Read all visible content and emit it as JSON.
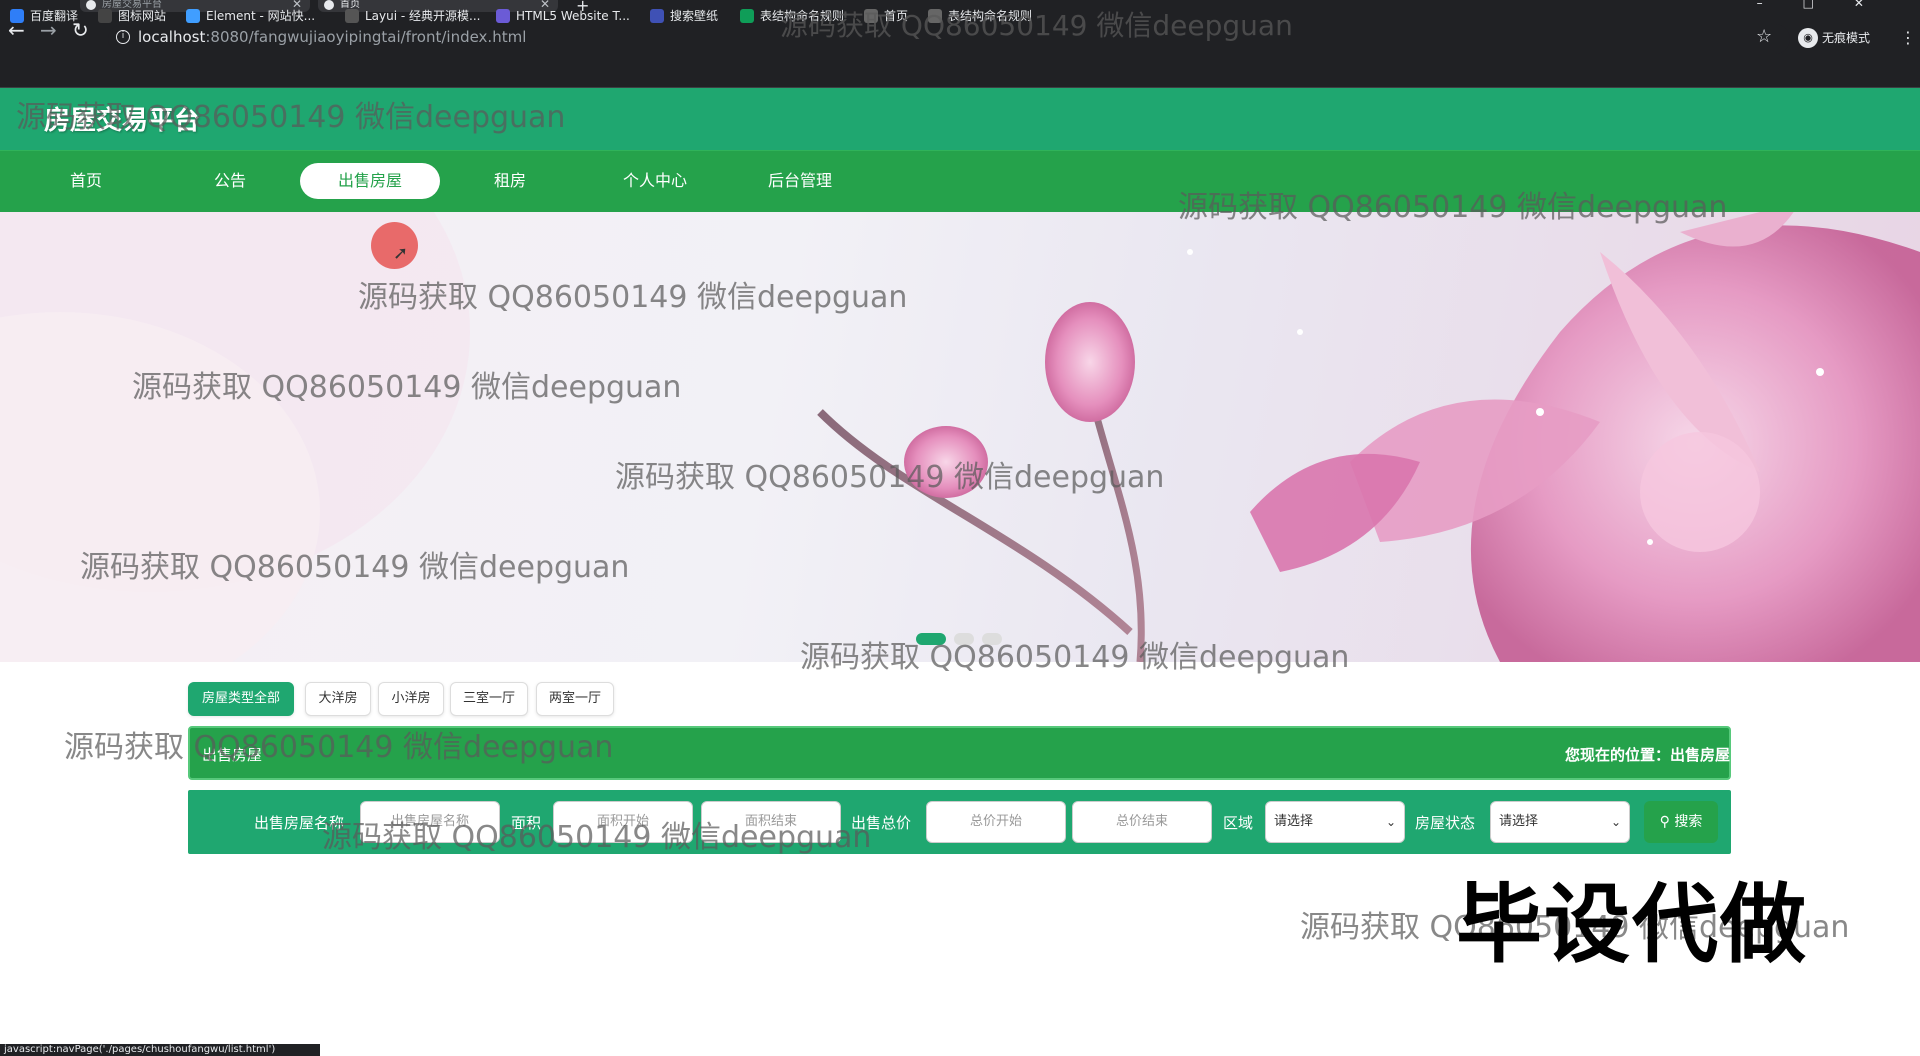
{
  "browser": {
    "tabs": [
      {
        "title": "房屋交易平台"
      },
      {
        "title": "首页"
      }
    ],
    "url_host": "localhost",
    "url_rest": ":8080/fangwujiaoyipingtai/front/index.html",
    "incognito_label": "无痕模式",
    "bookmarks": [
      {
        "label": "百度翻译",
        "icon": "baidu-translate-icon",
        "color": "#2f7ef7"
      },
      {
        "label": "图标网站",
        "icon": "flag-icon",
        "color": "#444"
      },
      {
        "label": "Element - 网站快...",
        "icon": "element-icon",
        "color": "#409eff"
      },
      {
        "label": "Layui - 经典开源模...",
        "icon": "layui-icon",
        "color": "#555"
      },
      {
        "label": "HTML5 Website T...",
        "icon": "html5-icon",
        "color": "#6b5bd6"
      },
      {
        "label": "搜索壁纸",
        "icon": "wallpaper-icon",
        "color": "#3f51b5"
      },
      {
        "label": "表结构命名规则",
        "icon": "sheet-icon",
        "color": "#0f9d58"
      },
      {
        "label": "首页",
        "icon": "globe-icon",
        "color": "#666"
      },
      {
        "label": "表结构命名规则",
        "icon": "globe-icon",
        "color": "#666"
      }
    ],
    "status_url": "javascript:navPage('./pages/chushoufangwu/list.html')"
  },
  "site": {
    "title": "房屋交易平台",
    "nav": [
      "首页",
      "公告",
      "出售房屋",
      "租房",
      "个人中心",
      "后台管理"
    ],
    "active_nav": "出售房屋"
  },
  "filters": {
    "house_types": [
      "房屋类型全部",
      "大洋房",
      "小洋房",
      "三室一厅",
      "两室一厅"
    ]
  },
  "breadcrumb": {
    "title": "出售房屋",
    "location": "您现在的位置：出售房屋"
  },
  "search": {
    "name_label": "出售房屋名称",
    "name_placeholder": "出售房屋名称",
    "area_label": "面积",
    "area_start": "面积开始",
    "area_end": "面积结束",
    "price_label": "出售总价",
    "price_start": "总价开始",
    "price_end": "总价结束",
    "region_label": "区域",
    "region_value": "请选择",
    "status_label": "房屋状态",
    "status_value": "请选择",
    "button": "搜索"
  },
  "watermark_text": "源码获取 QQ86050149 微信deepguan",
  "promo_text": "毕设代做",
  "colors": {
    "primary": "#1fa770",
    "nav": "#25a24b"
  }
}
